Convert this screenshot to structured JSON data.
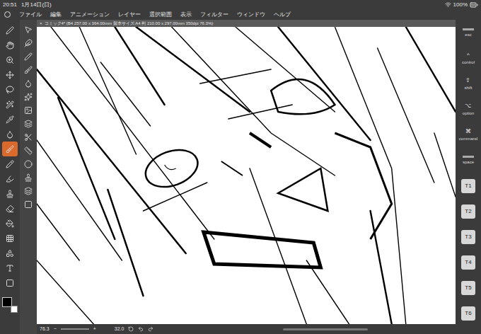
{
  "status_bar": {
    "time": "20:51",
    "date": "1月14日(日)",
    "battery": "100%"
  },
  "menu": [
    "ファイル",
    "編集",
    "アニメーション",
    "レイヤー",
    "選択範囲",
    "表示",
    "フィルター",
    "ウィンドウ",
    "ヘルプ"
  ],
  "document_tab": {
    "close": "×",
    "title": "コミック4* (B4 257.00 x 364.00mm 製本サイズ:A4 判 210.00 x 297.00mm 350dpi 76.3%)"
  },
  "tools": [
    {
      "selected": false
    },
    {
      "selected": false
    },
    {
      "selected": false
    },
    {
      "selected": false
    },
    {
      "selected": false
    },
    {
      "selected": false
    },
    {
      "selected": false
    },
    {
      "selected": false
    },
    {
      "selected": true
    },
    {
      "selected": false
    },
    {
      "selected": false
    },
    {
      "selected": false
    },
    {
      "selected": false
    },
    {
      "selected": false
    },
    {
      "selected": false
    },
    {
      "selected": false
    },
    {
      "selected": false
    },
    {
      "selected": false
    }
  ],
  "keys": [
    {
      "symbol": "",
      "label": "esc"
    },
    {
      "symbol": "^",
      "label": "control"
    },
    {
      "symbol": "⇧",
      "label": "shift"
    },
    {
      "symbol": "⌥",
      "label": "option"
    },
    {
      "symbol": "⌘",
      "label": "command"
    },
    {
      "symbol": "",
      "label": "space"
    },
    {
      "symbol": "T1",
      "label": ""
    },
    {
      "symbol": "T2",
      "label": ""
    },
    {
      "symbol": "T3",
      "label": ""
    },
    {
      "symbol": "T4",
      "label": ""
    },
    {
      "symbol": "T5",
      "label": ""
    },
    {
      "symbol": "T6",
      "label": ""
    }
  ],
  "bottom_bar": {
    "zoom": "76.3",
    "minus": "−",
    "plus": "+",
    "brush_size": "32.0"
  }
}
